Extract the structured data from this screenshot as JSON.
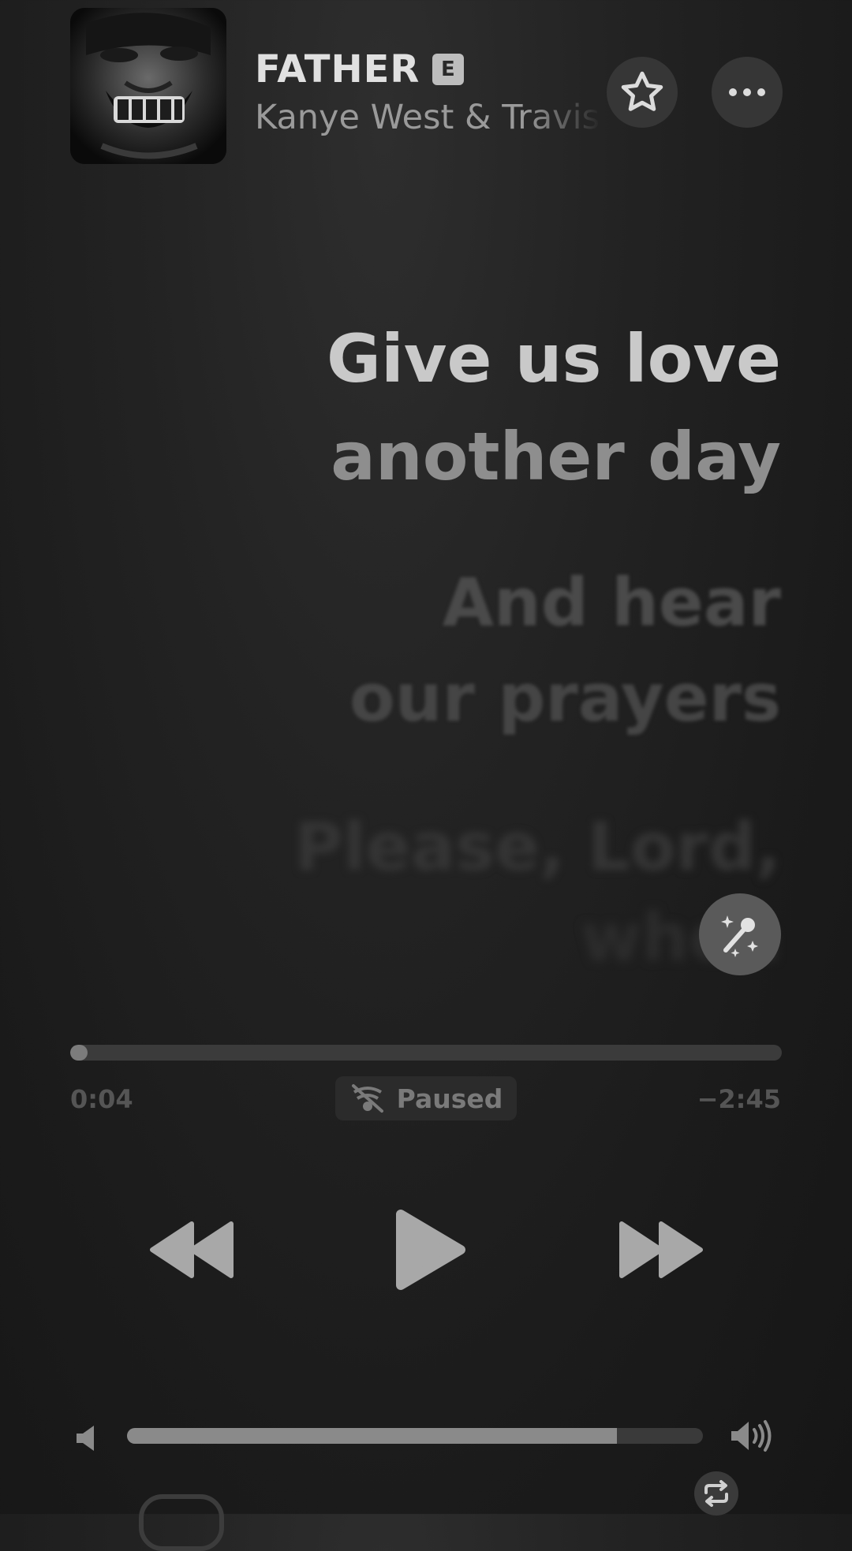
{
  "now_playing": {
    "title": "FATHER",
    "explicit_badge": "E",
    "artist": "Kanye West & Travis Scott"
  },
  "lyrics": {
    "line1": [
      "Give us love",
      "another day"
    ],
    "line2": [
      "And hear",
      "our prayers"
    ],
    "line3": [
      "Please, Lord,",
      "when"
    ]
  },
  "playback": {
    "elapsed": "0:04",
    "remaining": "−2:45",
    "status": "Paused",
    "progress": 0.024,
    "volume": 0.85
  },
  "icons": {
    "favorite": "star-icon",
    "more": "ellipsis-icon",
    "sing": "microphone-sparkles-icon",
    "status": "lyrics-off-icon",
    "rewind": "rewind-icon",
    "play": "play-icon",
    "forward": "fast-forward-icon",
    "volume_low": "speaker-low-icon",
    "volume_high": "speaker-high-icon",
    "repeat": "repeat-icon"
  },
  "colors": {
    "background": "#1c1c1c",
    "active_lyric": "#c9c9c9"
  }
}
